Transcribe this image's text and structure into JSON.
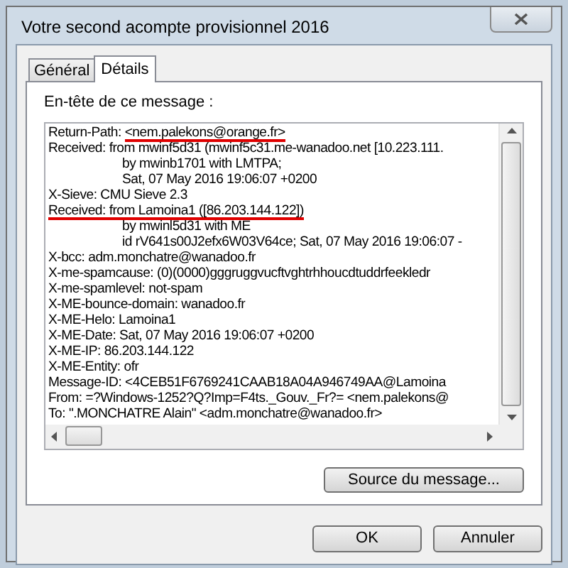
{
  "window": {
    "title": "Votre second acompte provisionnel 2016"
  },
  "tabs": [
    {
      "label": "Général",
      "selected": false
    },
    {
      "label": "Détails",
      "selected": true
    }
  ],
  "header_label": "En-tête de ce message :",
  "header_lines": [
    {
      "kind": "field",
      "text": "Return-Path: ",
      "value": "<nem.palekons@orange.fr>",
      "underlined": true
    },
    {
      "kind": "field",
      "text": "Received: from mwinf5d31 (mwinf5c31.me-wanadoo.net [10.223.111.",
      "underlined": false
    },
    {
      "kind": "continuation",
      "text": "by mwinb1701 with LMTPA;",
      "underlined": false
    },
    {
      "kind": "continuation",
      "text": "Sat, 07 May 2016 19:06:07 +0200",
      "underlined": false
    },
    {
      "kind": "field",
      "text": "X-Sieve: CMU Sieve 2.3",
      "underlined": false
    },
    {
      "kind": "field",
      "text": "Received: from Lamoina1 ([86.203.144.122])",
      "underlined": true
    },
    {
      "kind": "continuation",
      "text": "by mwinl5d31 with ME",
      "underlined": false
    },
    {
      "kind": "continuation",
      "text": "id rV641s00J2efx6W03V64ce; Sat, 07 May 2016 19:06:07 -",
      "underlined": false
    },
    {
      "kind": "field",
      "text": "X-bcc: adm.monchatre@wanadoo.fr",
      "underlined": false
    },
    {
      "kind": "field",
      "text": "X-me-spamcause: (0)(0000)gggruggvucftvghtrhhoucdtuddrfeekledr",
      "underlined": false
    },
    {
      "kind": "field",
      "text": "X-me-spamlevel: not-spam",
      "underlined": false
    },
    {
      "kind": "field",
      "text": "X-ME-bounce-domain: wanadoo.fr",
      "underlined": false
    },
    {
      "kind": "field",
      "text": "X-ME-Helo: Lamoina1",
      "underlined": false
    },
    {
      "kind": "field",
      "text": "X-ME-Date: Sat, 07 May 2016 19:06:07 +0200",
      "underlined": false
    },
    {
      "kind": "field",
      "text": "X-ME-IP: 86.203.144.122",
      "underlined": false
    },
    {
      "kind": "field",
      "text": "X-ME-Entity: ofr",
      "underlined": false
    },
    {
      "kind": "field",
      "text": "Message-ID: <4CEB51F6769241CAAB18A04A946749AA@Lamoina",
      "underlined": false
    },
    {
      "kind": "field",
      "text": "From: =?Windows-1252?Q?Imp=F4ts._Gouv._Fr?= <nem.palekons@",
      "underlined": false
    },
    {
      "kind": "field",
      "text": "To: \".MONCHATRE Alain\" <adm.monchatre@wanadoo.fr>",
      "underlined": false
    }
  ],
  "source_button": "Source du message...",
  "buttons": [
    "OK",
    "Annuler"
  ]
}
